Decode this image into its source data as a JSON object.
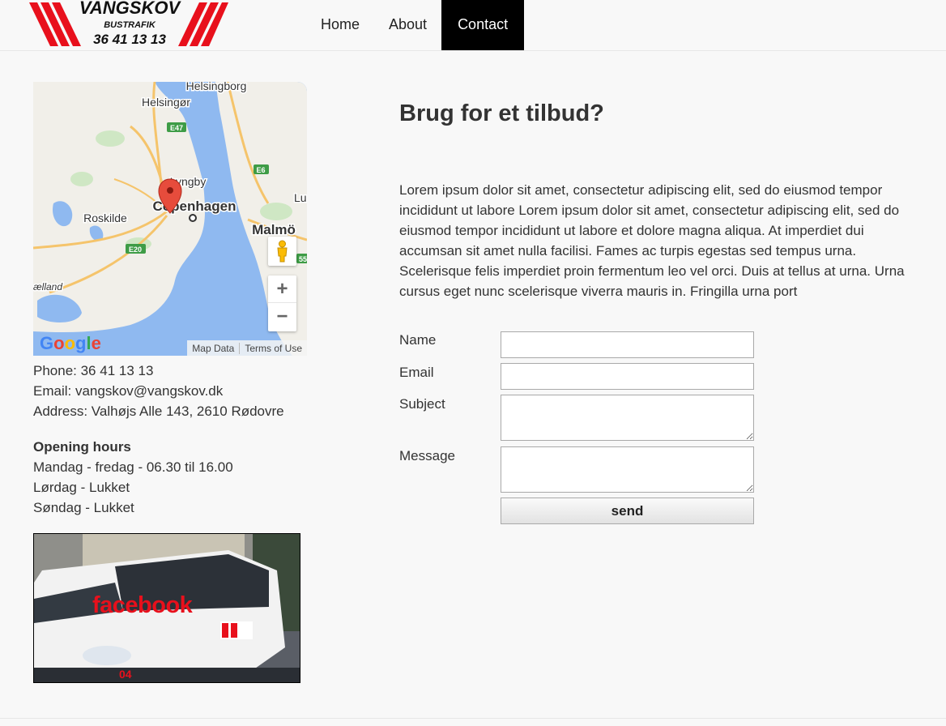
{
  "logo": {
    "name": "VANGSKOV",
    "tagline": "BUSTRAFIK",
    "phone": "36 41 13 13",
    "accent_color": "#e8101c"
  },
  "nav": {
    "items": [
      {
        "label": "Home",
        "active": false
      },
      {
        "label": "About",
        "active": false
      },
      {
        "label": "Contact",
        "active": true
      }
    ]
  },
  "map": {
    "places": [
      "Helsingborg",
      "Helsingør",
      "Lyngby",
      "Copenhagen",
      "Roskilde",
      "Malmö",
      "Lu",
      "ælland"
    ],
    "roads": [
      "E47",
      "E6",
      "E20",
      "55"
    ],
    "attribution": [
      "Map Data",
      "Terms of Use"
    ],
    "brand": "Google",
    "controls": {
      "zoom_in": "+",
      "zoom_out": "−"
    }
  },
  "contact": {
    "phone": "Phone: 36 41 13 13",
    "email": "Email: vangskov@vangskov.dk",
    "address": "Address: Valhøjs Alle 143, 2610 Rødovre"
  },
  "hours": {
    "title": "Opening hours",
    "lines": [
      {
        "day": "Mandag",
        "sep": " - ",
        "value": "fredag - 06.30 til 16.00"
      },
      {
        "day": "Lørdag",
        "sep": " - ",
        "value": "Lukket"
      },
      {
        "day": "Søndag",
        "sep": " - ",
        "value": "Lukket"
      }
    ]
  },
  "facebook": {
    "label": "facebook"
  },
  "form": {
    "heading": "Brug for et tilbud?",
    "intro": "Lorem ipsum dolor sit amet, consectetur adipiscing elit, sed do eiusmod tempor incididunt ut labore Lorem ipsum dolor sit amet, consectetur adipiscing elit, sed do eiusmod tempor incididunt ut labore et dolore magna aliqua. At imperdiet dui accumsan sit amet nulla facilisi. Fames ac turpis egestas sed tempus urna. Scelerisque felis imperdiet proin fermentum leo vel orci. Duis at tellus at urna. Urna cursus eget nunc scelerisque viverra mauris in. Fringilla urna port",
    "name_label": "Name",
    "email_label": "Email",
    "subject_label": "Subject",
    "message_label": "Message",
    "name_value": "",
    "email_value": "",
    "subject_value": "",
    "message_value": "",
    "submit_label": "send"
  }
}
